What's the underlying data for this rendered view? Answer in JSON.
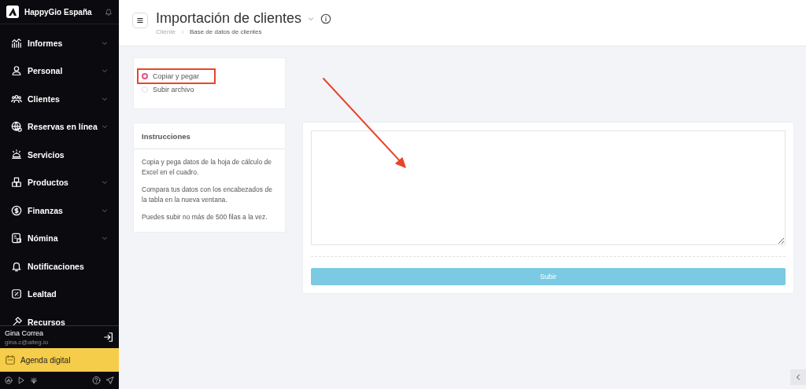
{
  "sidebar": {
    "brand": "HappyGio España",
    "items": [
      {
        "label": "Informes",
        "has_submenu": true
      },
      {
        "label": "Personal",
        "has_submenu": true
      },
      {
        "label": "Clientes",
        "has_submenu": true
      },
      {
        "label": "Reservas en línea",
        "has_submenu": true
      },
      {
        "label": "Servicios",
        "has_submenu": false
      },
      {
        "label": "Productos",
        "has_submenu": true
      },
      {
        "label": "Finanzas",
        "has_submenu": true
      },
      {
        "label": "Nómina",
        "has_submenu": true
      },
      {
        "label": "Notificaciones",
        "has_submenu": false
      },
      {
        "label": "Lealtad",
        "has_submenu": false
      },
      {
        "label": "Recursos",
        "has_submenu": false
      }
    ],
    "user": {
      "name": "Gina Correa",
      "email": "gina.c@alteg.io"
    },
    "agenda_button": "Agenda digital"
  },
  "header": {
    "title": "Importación de clientes",
    "breadcrumb": [
      "Cliente",
      "Base de datos de clientes"
    ]
  },
  "import_options": [
    {
      "label": "Copiar y pegar",
      "selected": true,
      "highlighted": true
    },
    {
      "label": "Subir archivo",
      "selected": false,
      "highlighted": false
    }
  ],
  "instructions": {
    "title": "Instrucciones",
    "paragraphs": [
      "Copia y pega datos de la hoja de cálculo de Excel en el cuadro.",
      "Compara tus datos con los encabezados de la tabla en la nueva ventana.",
      "Puedes subir no más de 500 filas a la vez."
    ]
  },
  "submit_button": "Subir"
}
